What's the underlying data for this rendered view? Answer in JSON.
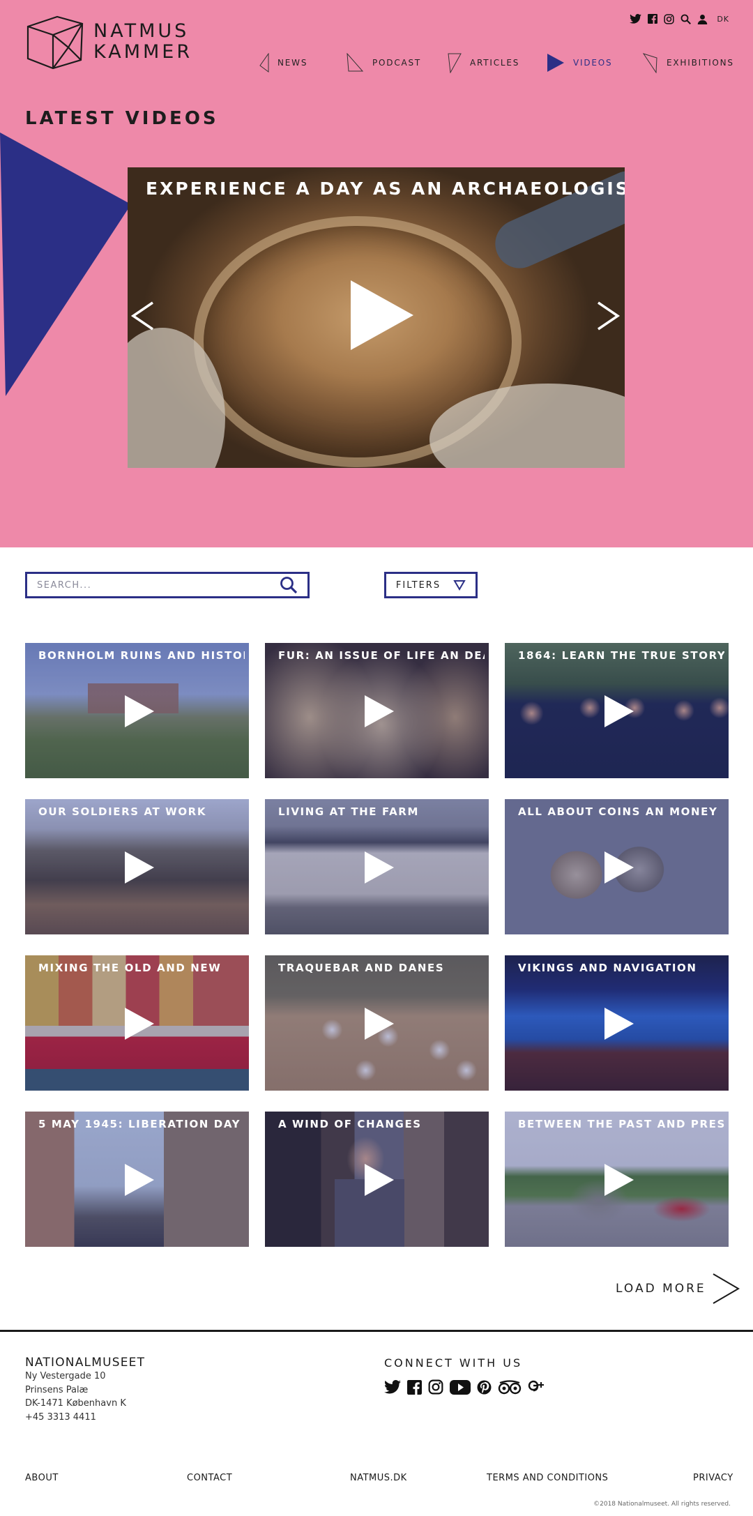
{
  "brand": {
    "line1": "NATMUS",
    "line2": "KAMMER",
    "colors": {
      "pink": "#ee89a9",
      "navy": "#2b2f86"
    }
  },
  "utility": {
    "icons": [
      "twitter-icon",
      "facebook-icon",
      "instagram-icon",
      "search-icon",
      "user-icon"
    ],
    "language": "DK"
  },
  "nav": {
    "items": [
      {
        "label": "NEWS",
        "active": false
      },
      {
        "label": "PODCAST",
        "active": false
      },
      {
        "label": "ARTICLES",
        "active": false
      },
      {
        "label": "VIDEOS",
        "active": true
      },
      {
        "label": "EXHIBITIONS",
        "active": false
      }
    ]
  },
  "hero": {
    "title": "LATEST VIDEOS",
    "featured_title": "EXPERIENCE A DAY AS AN ARCHAEOLOGIST"
  },
  "search": {
    "placeholder": "SEARCH...",
    "filters_label": "FILTERS"
  },
  "videos": [
    {
      "title": "BORNHOLM RUINS AND HISTORY"
    },
    {
      "title": "FUR: AN ISSUE OF LIFE AN DEATH"
    },
    {
      "title": "1864: LEARN THE TRUE STORY"
    },
    {
      "title": "OUR SOLDIERS AT WORK"
    },
    {
      "title": "LIVING AT THE FARM"
    },
    {
      "title": "ALL ABOUT COINS AN MONEY"
    },
    {
      "title": "MIXING THE OLD AND NEW"
    },
    {
      "title": "TRAQUEBAR AND DANES"
    },
    {
      "title": "VIKINGS AND NAVIGATION"
    },
    {
      "title": "5 MAY 1945: LIBERATION DAY"
    },
    {
      "title": "A WIND OF CHANGES"
    },
    {
      "title": "BETWEEN THE PAST AND PRESENT"
    }
  ],
  "load_more": "LOAD MORE",
  "footer": {
    "org": "NATIONALMUSEET",
    "address": [
      "Ny Vestergade 10",
      "Prinsens Palæ",
      "DK-1471 København K",
      "+45 3313 4411"
    ],
    "connect": "CONNECT WITH US",
    "social": [
      "twitter-icon",
      "facebook-icon",
      "instagram-icon",
      "youtube-icon",
      "pinterest-icon",
      "tripadvisor-icon",
      "google-plus-icon"
    ],
    "links": [
      "ABOUT",
      "CONTACT",
      "NATMUS.DK",
      "TERMS AND CONDITIONS",
      "PRIVACY"
    ],
    "copyright": "©2018 Nationalmuseet. All rights reserved."
  }
}
